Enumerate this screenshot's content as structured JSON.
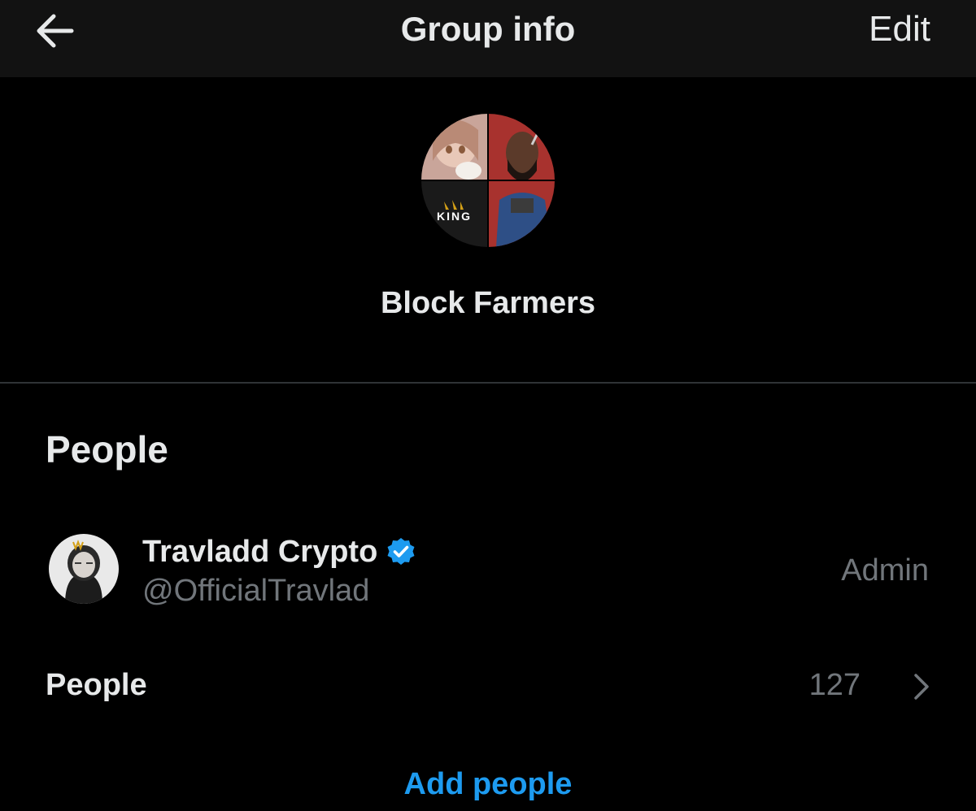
{
  "header": {
    "title": "Group info",
    "edit_label": "Edit",
    "back_icon": "arrow-left-icon"
  },
  "group": {
    "name": "Block Farmers",
    "avatar_quadrant_label": "KING"
  },
  "people_section": {
    "heading": "People",
    "members": [
      {
        "name": "Travladd Crypto",
        "handle": "@OfficialTravlad",
        "role": "Admin",
        "verified": true,
        "verified_color": "#1d9bf0"
      }
    ],
    "people_row": {
      "label": "People",
      "count": "127"
    },
    "add_people_label": "Add people"
  },
  "colors": {
    "background": "#000000",
    "header_background": "#121212",
    "primary_text": "#e7e9ea",
    "secondary_text": "#71767b",
    "accent": "#1d9bf0",
    "divider": "#2f3336"
  }
}
